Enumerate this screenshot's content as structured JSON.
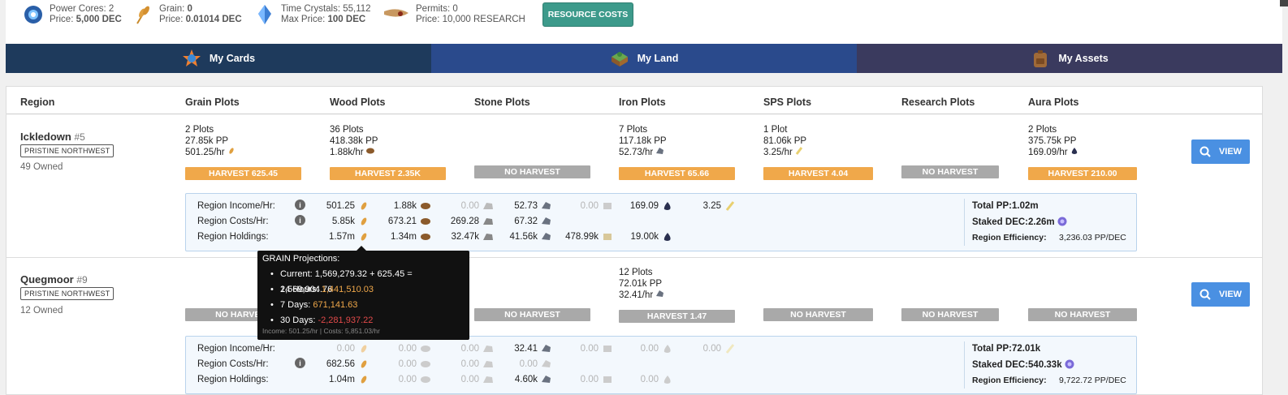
{
  "resources": [
    {
      "name": "power-cores",
      "line1": "Power Cores: 2",
      "line2": "Price: ",
      "line2b": "5,000 DEC",
      "icon": "power-core-icon"
    },
    {
      "name": "grain",
      "line1": "Grain: ",
      "line1b": "0",
      "line2": "Price: ",
      "line2b": "0.01014 DEC",
      "icon": "grain-icon"
    },
    {
      "name": "time-crystals",
      "line1": "Time Crystals: 55,112",
      "line2": "Max Price: ",
      "line2b": "100 DEC",
      "icon": "time-crystal-icon"
    },
    {
      "name": "permits",
      "line1": "Permits: 0",
      "line2": "Price: 10,000 RESEARCH",
      "line2b": "",
      "icon": "permit-icon"
    }
  ],
  "resource_costs_label": "RESOURCE COSTS",
  "nav": {
    "tabs": [
      {
        "label": "My Cards",
        "color": "#1e3a5c"
      },
      {
        "label": "My Land",
        "color": "#2a4a8c"
      },
      {
        "label": "My Assets",
        "color": "#3a3a5e"
      }
    ]
  },
  "headers": [
    "Region",
    "Grain Plots",
    "Wood Plots",
    "Stone Plots",
    "Iron Plots",
    "SPS Plots",
    "Research Plots",
    "Aura Plots"
  ],
  "view_label": "VIEW",
  "row_labels": {
    "income": "Region Income/Hr:",
    "costs": "Region Costs/Hr:",
    "holdings": "Region Holdings:",
    "total_pp": "Total PP:",
    "staked": "Staked DEC:",
    "efficiency": "Region Efficiency:"
  },
  "regions": [
    {
      "name": "Ickledown",
      "num": "#5",
      "tag": "PRISTINE NORTHWEST",
      "owned": "49 Owned",
      "plots": {
        "grain": [
          "2 Plots",
          "27.85k PP",
          "501.25/hr"
        ],
        "wood": [
          "36 Plots",
          "418.38k PP",
          "1.88k/hr"
        ],
        "iron": [
          "7 Plots",
          "117.18k PP",
          "52.73/hr"
        ],
        "sps": [
          "1 Plot",
          "81.06k PP",
          "3.25/hr"
        ],
        "aura": [
          "2 Plots",
          "375.75k PP",
          "169.09/hr"
        ]
      },
      "harvest": [
        "HARVEST 625.45",
        "HARVEST 2.35K",
        "NO HARVEST",
        "HARVEST 65.66",
        "HARVEST 4.04",
        "NO HARVEST",
        "HARVEST 210.00"
      ],
      "income": [
        "501.25",
        "1.88k",
        "0.00",
        "52.73",
        "0.00",
        "169.09",
        "3.25"
      ],
      "costs": [
        "5.85k",
        "673.21",
        "269.28",
        "67.32"
      ],
      "holdings": [
        "1.57m",
        "1.34m",
        "32.47k",
        "41.56k",
        "478.99k",
        "19.00k"
      ],
      "total_pp": "1.02m",
      "staked": "2.26m",
      "efficiency": "3,236.03 PP/DEC"
    },
    {
      "name": "Quegmoor",
      "num": "#9",
      "tag": "PRISTINE NORTHWEST",
      "owned": "12 Owned",
      "plots": {
        "iron": [
          "12 Plots",
          "72.01k PP",
          "32.41/hr"
        ]
      },
      "harvest": [
        "NO HARVEST",
        "",
        "NO HARVEST",
        "HARVEST 1.47",
        "NO HARVEST",
        "NO HARVEST",
        "NO HARVEST"
      ],
      "income": [
        "0.00",
        "0.00",
        "0.00",
        "32.41",
        "0.00",
        "0.00",
        "0.00"
      ],
      "costs": [
        "682.56",
        "0.00",
        "0.00",
        "0.00"
      ],
      "holdings": [
        "1.04m",
        "0.00",
        "0.00",
        "4.60k",
        "0.00",
        "0.00"
      ],
      "total_pp": "72.01k",
      "staked": "540.33k",
      "efficiency": "9,722.72 PP/DEC"
    }
  ],
  "tooltip": {
    "title": "GRAIN Projections:",
    "current_label": "Current: ",
    "current": "1,569,279.32 + 625.45 = 1,569,904.76",
    "h24_label": "24 Hours: ",
    "h24": "1,441,510.03",
    "d7_label": "7 Days: ",
    "d7": "671,141.63",
    "d30_label": "30 Days: ",
    "d30": "-2,281,937.22",
    "footer": "Income: 501.25/hr | Costs: 5,851.03/hr"
  },
  "colors": {
    "harvest": "#f0a84a",
    "no_harvest": "#a9a9a9",
    "view": "#4a90e2",
    "resource_costs": "#3d9a8b"
  }
}
